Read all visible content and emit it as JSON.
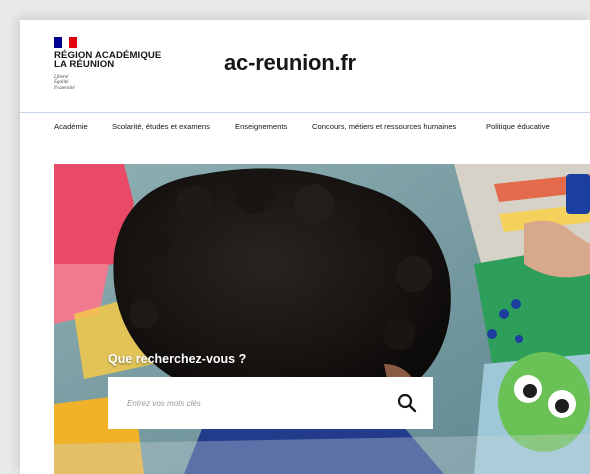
{
  "brand": {
    "flag_colors": [
      "#000091",
      "#ffffff",
      "#e1000f"
    ],
    "name_line1": "RÉGION ACADÉMIQUE",
    "name_line2": "LA RÉUNION",
    "motto": [
      "Liberté",
      "Égalité",
      "Fraternité"
    ]
  },
  "site": {
    "title": "ac-reunion.fr"
  },
  "nav": {
    "items": [
      "Académie",
      "Scolarité, études et examens",
      "Enseignements",
      "Concours, métiers et ressources humaines",
      "Politique éducative"
    ]
  },
  "search": {
    "label": "Que recherchez-vous ?",
    "placeholder": "Entrez vos mots clés",
    "button_icon": "search-icon"
  },
  "colors": {
    "header_border": "#c7d5e8",
    "text": "#161616",
    "accent": "#000091"
  }
}
